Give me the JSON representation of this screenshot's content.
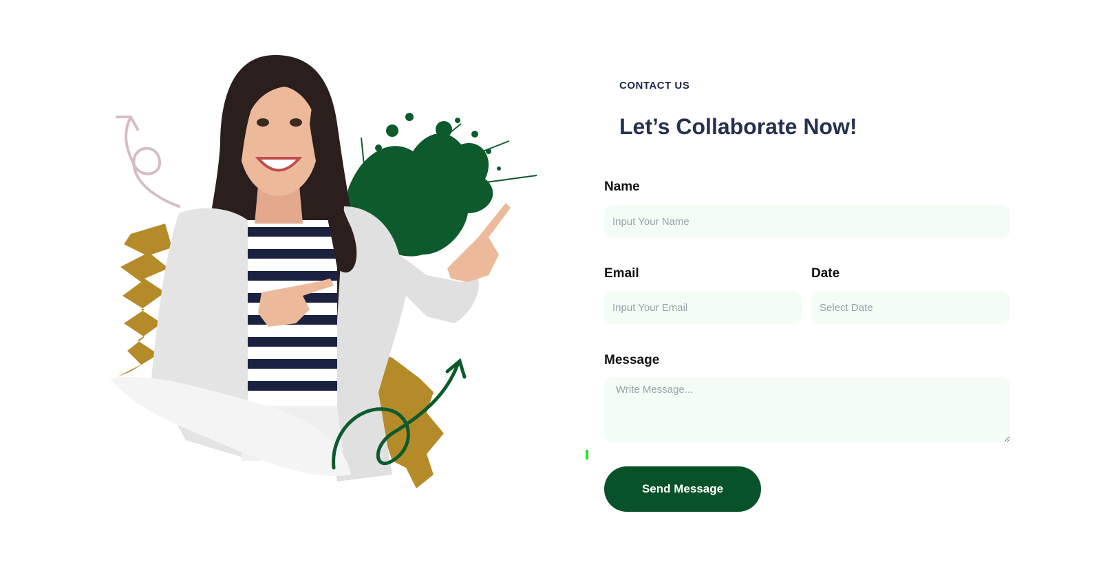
{
  "section": {
    "eyebrow": "CONTACT US",
    "heading": "Let’s Collaborate Now!"
  },
  "form": {
    "name": {
      "label": "Name",
      "placeholder": "Input Your Name",
      "value": ""
    },
    "email": {
      "label": "Email",
      "placeholder": "Input Your Email",
      "value": ""
    },
    "date": {
      "label": "Date",
      "placeholder": "Select Date",
      "value": ""
    },
    "message": {
      "label": "Message",
      "placeholder": "Write Message...",
      "value": ""
    },
    "submit_label": "Send Message"
  },
  "illustration": {
    "subject": "smiling woman pointing",
    "decorations": [
      "pink-curly-arrow",
      "green-paint-splash",
      "gold-brush-stroke",
      "green-curly-arrow"
    ]
  },
  "colors": {
    "heading": "#26304f",
    "eyebrow": "#1c2647",
    "input_background": "#f3fdf6",
    "button": "#075229",
    "button_text": "#ffffff",
    "splash_green": "#0d5a2c",
    "brush_gold": "#b58b2a",
    "arrow_pink": "#d6bcc3"
  }
}
